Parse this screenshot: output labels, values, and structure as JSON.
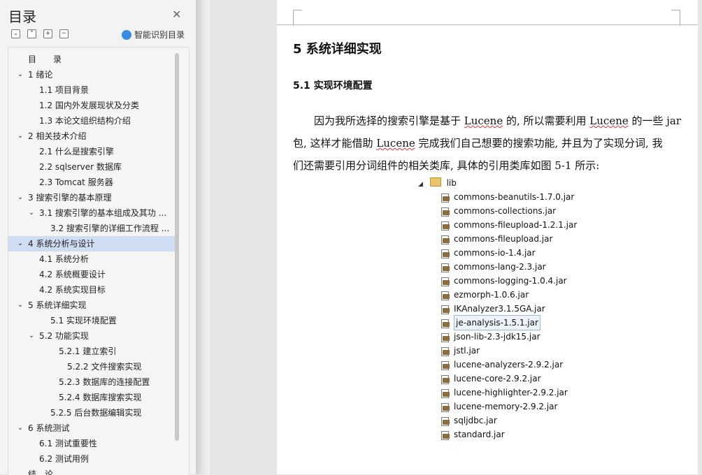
{
  "sidebar": {
    "title": "目录",
    "ai_label": "智能识别目录",
    "toc": [
      {
        "label": "目　　录",
        "level": 0,
        "chev": ""
      },
      {
        "label": "1  绪论",
        "level": 0,
        "chev": "v"
      },
      {
        "label": "1.1  项目背景",
        "level": 1,
        "chev": ""
      },
      {
        "label": "1.2  国内外发展现状及分类",
        "level": 1,
        "chev": ""
      },
      {
        "label": "1.3  本论文组织结构介绍",
        "level": 1,
        "chev": ""
      },
      {
        "label": "2  相关技术介绍",
        "level": 0,
        "chev": "v"
      },
      {
        "label": "2.1 什么是搜索引擎",
        "level": 1,
        "chev": ""
      },
      {
        "label": "2.2    sqlserver 数据库",
        "level": 1,
        "chev": ""
      },
      {
        "label": "2.3 Tomcat 服务器",
        "level": 1,
        "chev": ""
      },
      {
        "label": "3  搜索引擎的基本原理",
        "level": 0,
        "chev": "v"
      },
      {
        "label": "3.1 搜索引擎的基本组成及其功 ...",
        "level": 1,
        "chev": "v"
      },
      {
        "label": "3.2 搜索引擎的详细工作流程   ...",
        "level": 2,
        "chev": ""
      },
      {
        "label": "4  系统分析与设计",
        "level": 0,
        "chev": "v",
        "selected": true
      },
      {
        "label": "4.1 系统分析",
        "level": 1,
        "chev": ""
      },
      {
        "label": "4.2 系统概要设计",
        "level": 1,
        "chev": ""
      },
      {
        "label": "4.2 系统实现目标",
        "level": 1,
        "chev": ""
      },
      {
        "label": "5  系统详细实现",
        "level": 0,
        "chev": "v"
      },
      {
        "label": "5.1 实现环境配置",
        "level": 2,
        "chev": ""
      },
      {
        "label": "5.2 功能实现",
        "level": 1,
        "chev": "v"
      },
      {
        "label": "5.2.1    建立索引",
        "level": 3,
        "chev": ""
      },
      {
        "label": "5.2.2    文件搜索实现",
        "level": 4,
        "chev": ""
      },
      {
        "label": "5.2.3    数据库的连接配置",
        "level": 3,
        "chev": ""
      },
      {
        "label": "5.2.4    数据库搜索实现",
        "level": 3,
        "chev": ""
      },
      {
        "label": "5.2.5    后台数据编辑实现",
        "level": 2,
        "chev": ""
      },
      {
        "label": "6  系统测试",
        "level": 0,
        "chev": "v"
      },
      {
        "label": "6.1 测试重要性",
        "level": 1,
        "chev": ""
      },
      {
        "label": "6.2 测试用例",
        "level": 1,
        "chev": ""
      },
      {
        "label": "结　论",
        "level": 0,
        "chev": ""
      }
    ]
  },
  "document": {
    "heading1": "5  系统详细实现",
    "heading2": "5.1 实现环境配置",
    "para": [
      [
        "　　因为我所选择的搜索引擎是基于 ",
        "Lucene",
        " 的, 所以需要利用 ",
        "Lucene",
        " 的一些 jar"
      ],
      [
        "包, 这样才能借助 ",
        "Lucene",
        " 完成我们自己想要的搜索功能, 并且为了实现分词, 我"
      ],
      [
        "们还需要引用分词组件的相关类库, 具体的引用类库如图 5-1 所示:"
      ]
    ],
    "tree_root": "lib",
    "jars": [
      "commons-beanutils-1.7.0.jar",
      "commons-collections.jar",
      "commons-fileupload-1.2.1.jar",
      "commons-fileupload.jar",
      "commons-io-1.4.jar",
      "commons-lang-2.3.jar",
      "commons-logging-1.0.4.jar",
      "ezmorph-1.0.6.jar",
      "IKAnalyzer3.1.5GA.jar",
      "je-analysis-1.5.1.jar",
      "json-lib-2.3-jdk15.jar",
      "jstl.jar",
      "lucene-analyzers-2.9.2.jar",
      "lucene-core-2.9.2.jar",
      "lucene-highlighter-2.9.2.jar",
      "lucene-memory-2.9.2.jar",
      "sqljdbc.jar",
      "standard.jar"
    ],
    "highlighted_jar": "je-analysis-1.5.1.jar"
  }
}
